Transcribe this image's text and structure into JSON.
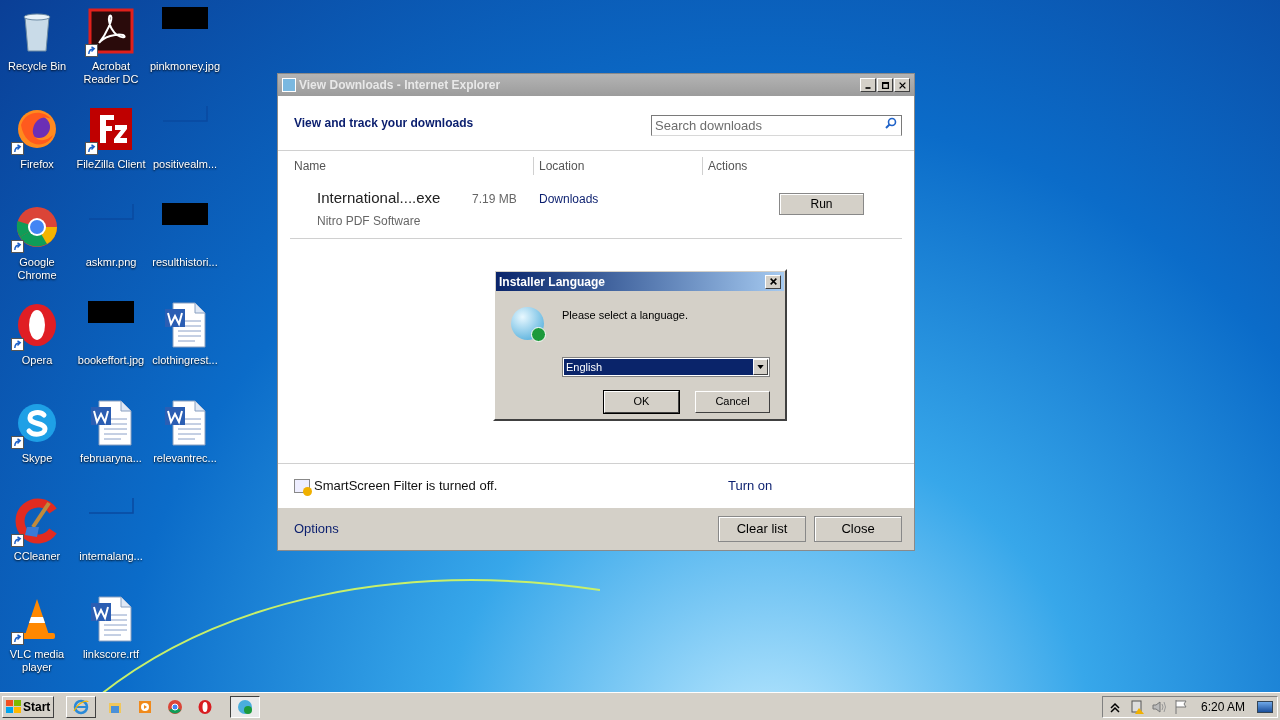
{
  "desktop": {
    "icons": [
      {
        "label": "Recycle Bin",
        "kind": "recycle",
        "shortcut": false
      },
      {
        "label": "Firefox",
        "kind": "firefox",
        "shortcut": true
      },
      {
        "label": "Google Chrome",
        "kind": "chrome",
        "shortcut": true
      },
      {
        "label": "Opera",
        "kind": "opera",
        "shortcut": true
      },
      {
        "label": "Skype",
        "kind": "skype",
        "shortcut": true
      },
      {
        "label": "CCleaner",
        "kind": "ccleaner",
        "shortcut": true
      },
      {
        "label": "VLC media player",
        "kind": "vlc",
        "shortcut": true
      },
      {
        "label": "Acrobat Reader DC",
        "kind": "acrobat",
        "shortcut": true
      },
      {
        "label": "FileZilla Client",
        "kind": "filezilla",
        "shortcut": true
      },
      {
        "label": "askmr.png",
        "kind": "blank_image",
        "shortcut": false
      },
      {
        "label": "bookeffort.jpg",
        "kind": "dark_image",
        "shortcut": false
      },
      {
        "label": "februaryna...",
        "kind": "word",
        "shortcut": false
      },
      {
        "label": "internalang...",
        "kind": "blank_image",
        "shortcut": false
      },
      {
        "label": "linkscore.rtf",
        "kind": "word",
        "shortcut": false
      },
      {
        "label": "pinkmoney.jpg",
        "kind": "dark_image",
        "shortcut": false
      },
      {
        "label": "positivealm...",
        "kind": "blank_image",
        "shortcut": false
      },
      {
        "label": "resulthistori...",
        "kind": "dark_image",
        "shortcut": false
      },
      {
        "label": "clothingrest...",
        "kind": "word",
        "shortcut": false
      },
      {
        "label": "relevantrec...",
        "kind": "word",
        "shortcut": false
      }
    ]
  },
  "downloads_window": {
    "title": "View Downloads - Internet Explorer",
    "heading": "View and track your downloads",
    "search": {
      "placeholder": "Search downloads"
    },
    "columns": [
      "Name",
      "Location",
      "Actions"
    ],
    "items": [
      {
        "name": "International....exe",
        "size": "7.19 MB",
        "publisher": "Nitro PDF Software",
        "location": "Downloads",
        "action": "Run"
      }
    ],
    "smartscreen": {
      "message": "SmartScreen Filter is turned off.",
      "link": "Turn on"
    },
    "footer": {
      "link": "Options",
      "buttons": [
        "Clear list",
        "Close"
      ]
    }
  },
  "dialog": {
    "title": "Installer Language",
    "message": "Please select a language.",
    "language": "English",
    "buttons": [
      {
        "label": "OK",
        "default": true
      },
      {
        "label": "Cancel",
        "default": false
      }
    ]
  },
  "taskbar": {
    "start": "Start",
    "items": [
      {
        "kind": "ie",
        "selected": false
      },
      {
        "kind": "folder"
      },
      {
        "kind": "media"
      },
      {
        "kind": "chrome"
      },
      {
        "kind": "opera"
      },
      {
        "kind": "installer",
        "selected": true
      }
    ],
    "time": "6:20 AM"
  }
}
